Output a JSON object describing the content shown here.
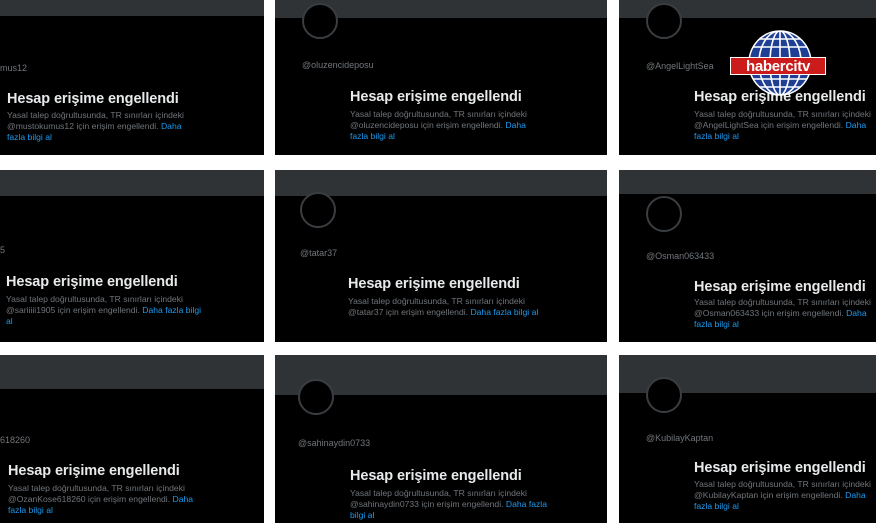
{
  "common": {
    "title": "Hesap erişime engellendi",
    "desc_prefix": "Yasal talep doğrultusunda, TR sınırları içindeki",
    "desc_suffix": "için erişim engellendi.",
    "more": "Daha fazla bilgi al"
  },
  "tiles": [
    {
      "handle": "mus12",
      "mention": "@mustokumus12"
    },
    {
      "handle": "@oluzencideposu",
      "mention": "@oluzencideposu"
    },
    {
      "handle": "@AngelLightSea",
      "mention": "@AngelLightSea"
    },
    {
      "handle": "5",
      "mention": "@sariiiii1905"
    },
    {
      "handle": "@tatar37",
      "mention": "@tatar37"
    },
    {
      "handle": "@Osman063433",
      "mention": "@Osman063433"
    },
    {
      "handle": "618260",
      "mention": "@OzanKose618260"
    },
    {
      "handle": "@sahinaydin0733",
      "mention": "@sahinaydin0733"
    },
    {
      "handle": "@KubilayKaptan",
      "mention": "@KubilayKaptan"
    }
  ],
  "logo": {
    "text": "habercitv",
    "red": "#cc1b1b",
    "blue": "#1f3f95"
  }
}
